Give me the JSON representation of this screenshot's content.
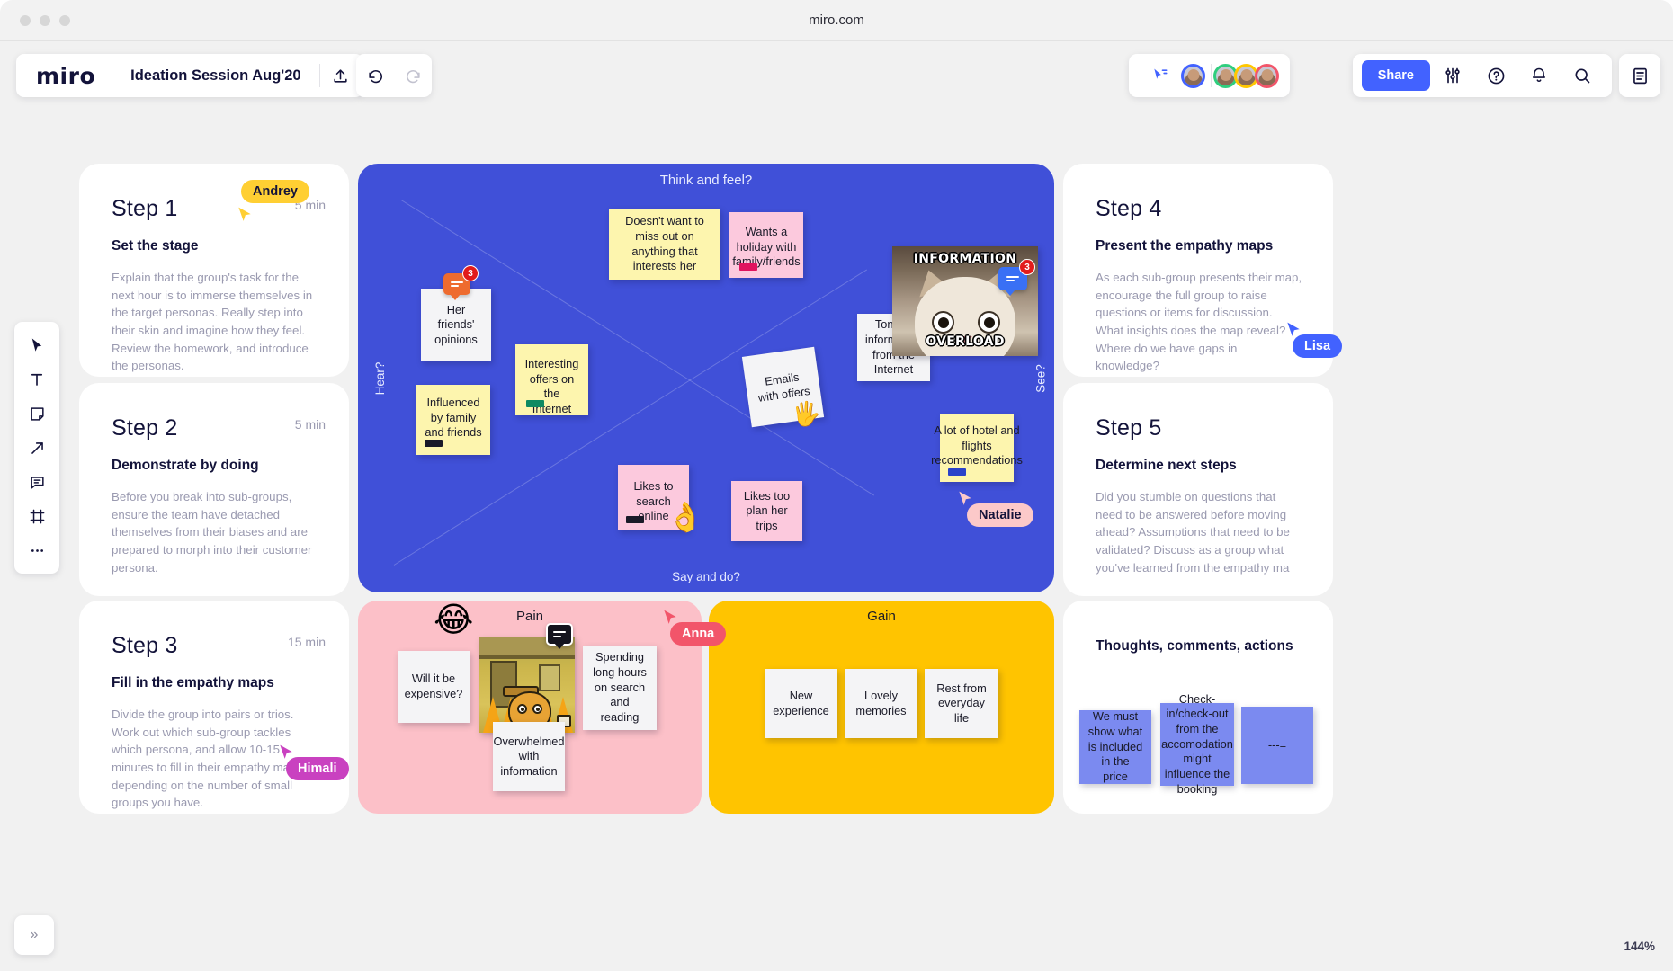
{
  "browser": {
    "url": "miro.com"
  },
  "toolbar": {
    "logo": "miro",
    "board_title": "Ideation Session Aug'20",
    "upload_icon": "upload-icon",
    "undo_icon": "undo-icon",
    "redo_icon": "redo-icon",
    "share_label": "Share",
    "settings_icon": "sliders-icon",
    "help_icon": "question-circle-icon",
    "notifications_icon": "bell-icon",
    "search_icon": "search-icon",
    "notes_icon": "notes-panel-icon",
    "cursor_share_icon": "cursor-share-icon"
  },
  "tool_palette": [
    {
      "name": "select-tool",
      "icon": "cursor-arrow-icon"
    },
    {
      "name": "text-tool",
      "icon": "text-T-icon"
    },
    {
      "name": "sticky-note-tool",
      "icon": "sticky-note-icon"
    },
    {
      "name": "shapes-tool",
      "icon": "arrow-diagonal-icon"
    },
    {
      "name": "comment-tool",
      "icon": "comment-icon"
    },
    {
      "name": "frame-tool",
      "icon": "frame-icon"
    },
    {
      "name": "more-tools",
      "icon": "ellipsis-icon"
    }
  ],
  "zoom": {
    "level": "144%"
  },
  "collapse": {
    "icon": "chevron-double-right-icon"
  },
  "cards": {
    "step1": {
      "title": "Step 1",
      "time": "5 min",
      "subtitle": "Set the stage",
      "body": "Explain that the group's task for the next hour is to immerse themselves in the target personas. Really step into their skin and imagine how they feel. Review the homework, and introduce the personas."
    },
    "step2": {
      "title": "Step 2",
      "time": "5 min",
      "subtitle": "Demonstrate by doing",
      "body": "Before you break into sub-groups, ensure the team have detached themselves from their biases and are prepared to morph into their customer persona."
    },
    "step3": {
      "title": "Step 3",
      "time": "15 min",
      "subtitle": "Fill in the empathy maps",
      "body": "Divide the group into pairs or trios. Work out which sub-group tackles which persona, and allow 10-15 minutes to fill in their empathy map, depending on the number of small groups you have."
    },
    "step4": {
      "title": "Step 4",
      "time": "",
      "subtitle": "Present the empathy maps",
      "body": "As each sub-group presents their map, encourage the full group to raise questions or items for discussion. What insights does the map reveal? Where do we have gaps in knowledge?"
    },
    "step5": {
      "title": "Step 5",
      "time": "",
      "subtitle": "Determine next steps",
      "body": "Did you stumble on questions that need to be answered before moving ahead? Assumptions that need to be validated? Discuss as a group what you've learned from the empathy ma"
    },
    "thoughts": {
      "title": "Thoughts, comments, actions"
    }
  },
  "empathy_map": {
    "top_label": "Think and feel?",
    "left_label": "Hear?",
    "right_label": "See?",
    "bottom_label": "Say and do?",
    "background": "#4050d8",
    "notes": [
      {
        "text": "Her friends' opinions",
        "color": "white",
        "comments": 3,
        "comment_color": "orange"
      },
      {
        "text": "Doesn't want to miss out on anything that interests her",
        "color": "yellow"
      },
      {
        "text": "Wants a holiday with family/friends",
        "color": "pink",
        "tag": "pinkd"
      },
      {
        "text": "Interesting offers on the Internet",
        "color": "yellow",
        "tag": "green"
      },
      {
        "text": "Influenced by family and friends",
        "color": "yellow",
        "tag": "dark"
      },
      {
        "text": "Emails with offers",
        "color": "white"
      },
      {
        "text": "Tons of information from the Internet",
        "color": "white"
      },
      {
        "text": "A lot of hotel and flights recommendations",
        "color": "yellow",
        "tag": "blued"
      },
      {
        "text": "Likes to search online",
        "color": "pink",
        "tag": "dark"
      },
      {
        "text": "Likes too plan her trips",
        "color": "pink"
      }
    ],
    "meme": {
      "caption_top": "INFORMATION",
      "caption_bottom": "OVERLOAD",
      "comments": 3
    }
  },
  "pain_board": {
    "title": "Pain",
    "emoji": "😂",
    "comment_icon": "comment-icon",
    "notes": [
      {
        "text": "Will it be expensive?"
      },
      {
        "text": "Spending long hours on search and reading"
      },
      {
        "text": "Overwhelmed with information"
      }
    ]
  },
  "gain_board": {
    "title": "Gain",
    "notes": [
      {
        "text": "New experience"
      },
      {
        "text": "Lovely memories"
      },
      {
        "text": "Rest from everyday life"
      }
    ]
  },
  "thoughts_notes": [
    {
      "text": "We must show what is included in the price"
    },
    {
      "text": "Check-in/check-out from the accomodation might influence the booking"
    },
    {
      "text": "---="
    }
  ],
  "collaborators": [
    {
      "name": "Andrey",
      "color": "#ffcf33"
    },
    {
      "name": "Lisa",
      "color": "#4262ff",
      "text_color": "#ffffff"
    },
    {
      "name": "Natalie",
      "color": "#fcc9c9"
    },
    {
      "name": "Anna",
      "color": "#f2556a",
      "text_color": "#ffffff"
    },
    {
      "name": "Himali",
      "color": "#c941c0",
      "text_color": "#ffffff"
    }
  ]
}
